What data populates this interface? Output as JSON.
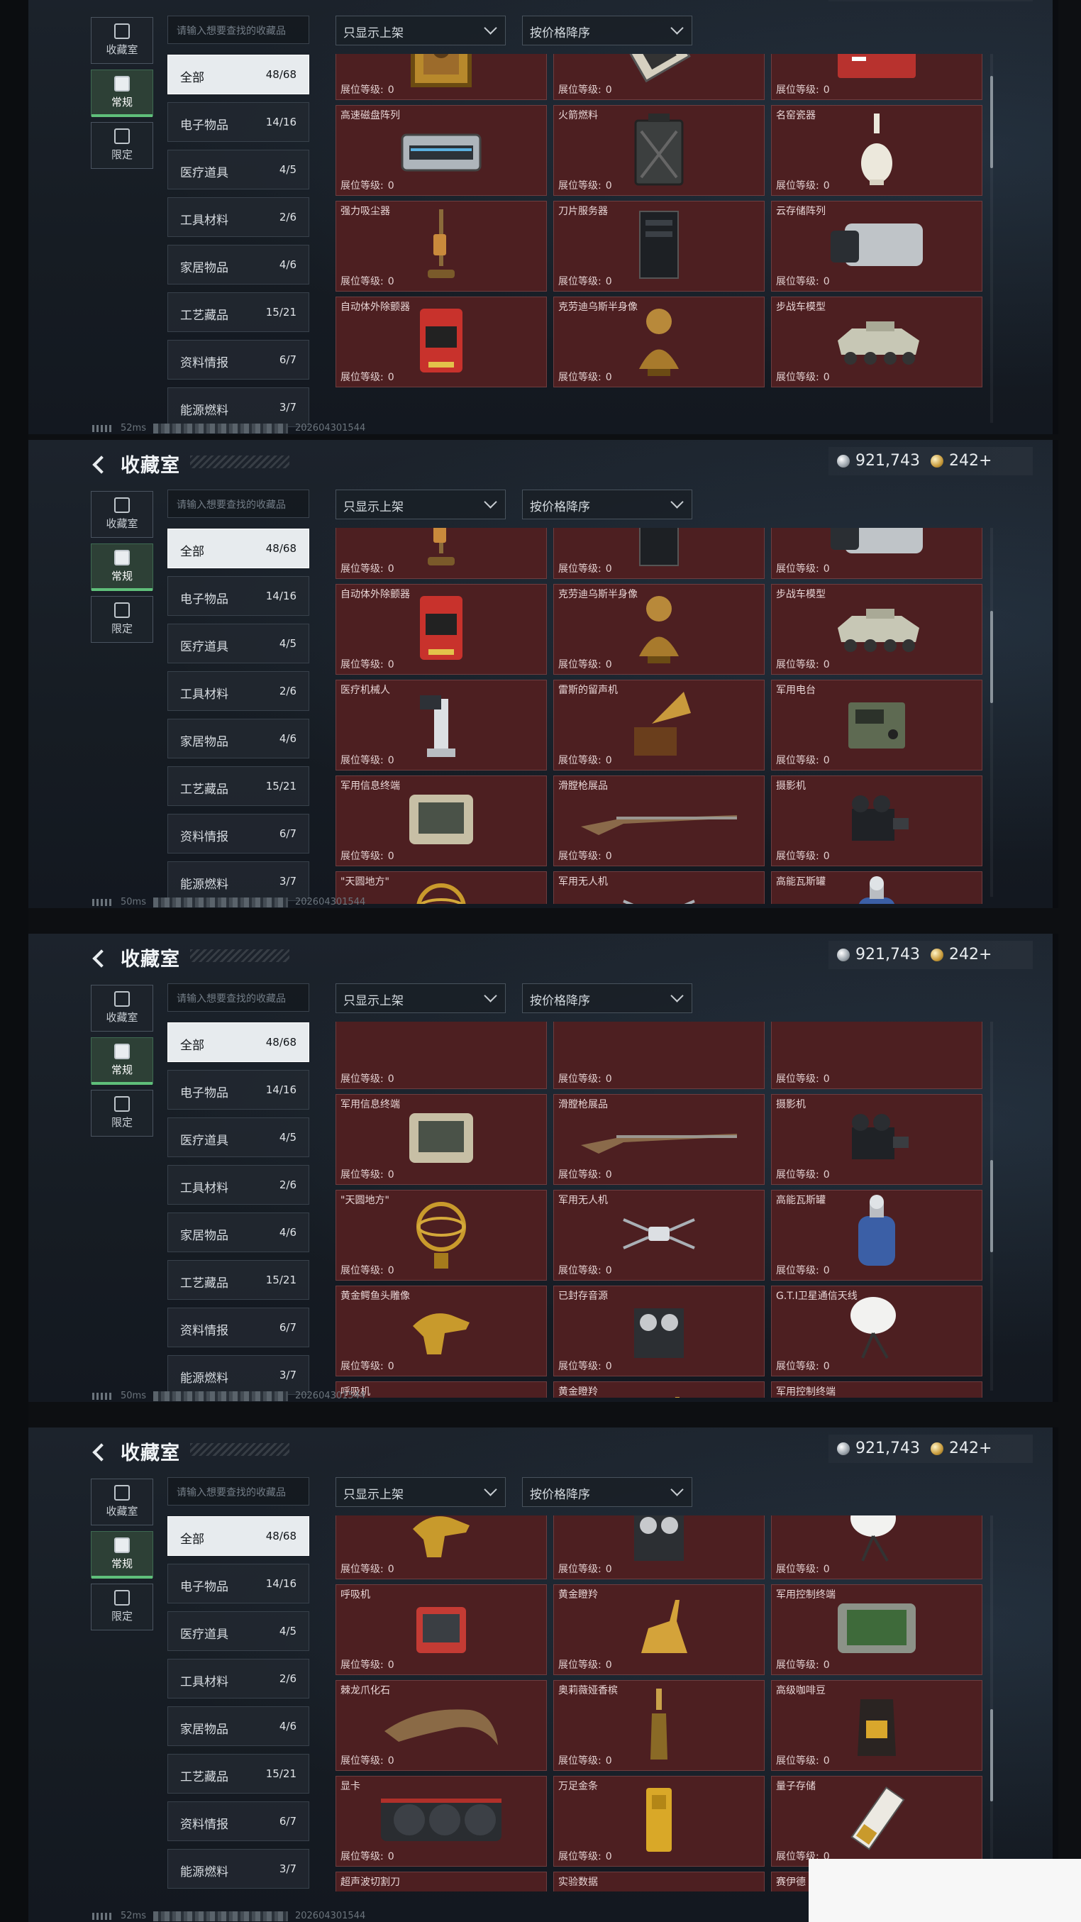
{
  "title": "收藏室",
  "currency": {
    "silver": "921,743",
    "gold": "242+"
  },
  "tabs": [
    {
      "label": "收藏室",
      "icon": "collection-icon"
    },
    {
      "label": "常规",
      "icon": "regular-icon"
    },
    {
      "label": "限定",
      "icon": "limited-icon"
    }
  ],
  "search_placeholder": "请输入想要查找的收藏品",
  "filter_label": "只显示上架",
  "sort_label": "按价格降序",
  "categories": [
    {
      "label": "全部",
      "count": "48/68"
    },
    {
      "label": "电子物品",
      "count": "14/16"
    },
    {
      "label": "医疗道具",
      "count": "4/5"
    },
    {
      "label": "工具材料",
      "count": "2/6"
    },
    {
      "label": "家居物品",
      "count": "4/6"
    },
    {
      "label": "工艺藏品",
      "count": "15/21"
    },
    {
      "label": "资料情报",
      "count": "6/7"
    },
    {
      "label": "能源燃料",
      "count": "3/7"
    }
  ],
  "level_label": "展位等级:",
  "level_value": "0",
  "panels": [
    {
      "ping": "52ms",
      "stamp": "202604301544",
      "scroll": 0.08,
      "rows": [
        [
          {
            "name": "",
            "icon": "painting-icon"
          },
          {
            "name": "",
            "icon": "chip-icon"
          },
          {
            "name": "",
            "icon": "fuel-can-icon"
          }
        ],
        [
          {
            "name": "高速磁盘阵列",
            "icon": "disk-array-icon"
          },
          {
            "name": "火箭燃料",
            "icon": "jerrycan-icon"
          },
          {
            "name": "名窑瓷器",
            "icon": "porcelain-vase-icon"
          }
        ],
        [
          {
            "name": "强力吸尘器",
            "icon": "vacuum-icon"
          },
          {
            "name": "刀片服务器",
            "icon": "server-icon"
          },
          {
            "name": "云存储阵列",
            "icon": "storage-array-icon"
          }
        ],
        [
          {
            "name": "自动体外除颤器",
            "icon": "defibrillator-icon"
          },
          {
            "name": "克劳迪乌斯半身像",
            "icon": "bust-icon"
          },
          {
            "name": "步战车模型",
            "icon": "tank-model-icon"
          }
        ]
      ]
    },
    {
      "ping": "50ms",
      "stamp": "202604301544",
      "scroll": 0.3,
      "rows": [
        [
          {
            "name": "",
            "icon": "vacuum-icon"
          },
          {
            "name": "",
            "icon": "server-icon"
          },
          {
            "name": "",
            "icon": "storage-array-icon"
          }
        ],
        [
          {
            "name": "自动体外除颤器",
            "icon": "defibrillator-icon"
          },
          {
            "name": "克劳迪乌斯半身像",
            "icon": "bust-icon"
          },
          {
            "name": "步战车模型",
            "icon": "tank-model-icon"
          }
        ],
        [
          {
            "name": "医疗机械人",
            "icon": "medical-robot-icon"
          },
          {
            "name": "雷斯的留声机",
            "icon": "gramophone-icon"
          },
          {
            "name": "军用电台",
            "icon": "radio-icon"
          }
        ],
        [
          {
            "name": "军用信息终端",
            "icon": "terminal-icon"
          },
          {
            "name": "滑膛枪展品",
            "icon": "musket-icon"
          },
          {
            "name": "摄影机",
            "icon": "camera-icon"
          }
        ],
        [
          {
            "name": "\"天圆地方\"",
            "icon": "armillary-icon"
          },
          {
            "name": "军用无人机",
            "icon": "drone-icon"
          },
          {
            "name": "高能瓦斯罐",
            "icon": "gas-tank-icon"
          }
        ]
      ]
    },
    {
      "ping": "50ms",
      "stamp": "202604301544",
      "scroll": 0.5,
      "rows": [
        [
          {
            "name": "",
            "icon": "blank-icon"
          },
          {
            "name": "",
            "icon": "blank-icon"
          },
          {
            "name": "",
            "icon": "blank-icon"
          }
        ],
        [
          {
            "name": "军用信息终端",
            "icon": "terminal-icon"
          },
          {
            "name": "滑膛枪展品",
            "icon": "musket-icon"
          },
          {
            "name": "摄影机",
            "icon": "camera-icon"
          }
        ],
        [
          {
            "name": "\"天圆地方\"",
            "icon": "armillary-icon"
          },
          {
            "name": "军用无人机",
            "icon": "drone-icon"
          },
          {
            "name": "高能瓦斯罐",
            "icon": "gas-tank-icon"
          }
        ],
        [
          {
            "name": "黄金鳄鱼头雕像",
            "icon": "croc-statue-icon"
          },
          {
            "name": "已封存音源",
            "icon": "tape-recorder-icon"
          },
          {
            "name": "G.T.I卫星通信天线",
            "icon": "satellite-dish-icon"
          }
        ],
        [
          {
            "name": "呼吸机",
            "icon": "ventilator-icon"
          },
          {
            "name": "黄金瞪羚",
            "icon": "gazelle-icon"
          },
          {
            "name": "军用控制终端",
            "icon": "control-terminal-icon"
          }
        ]
      ]
    },
    {
      "ping": "52ms",
      "stamp": "202604301544",
      "scroll": 0.7,
      "rows": [
        [
          {
            "name": "",
            "icon": "croc-statue-icon"
          },
          {
            "name": "",
            "icon": "tape-recorder-icon"
          },
          {
            "name": "",
            "icon": "satellite-dish-icon"
          }
        ],
        [
          {
            "name": "呼吸机",
            "icon": "ventilator-icon"
          },
          {
            "name": "黄金瞪羚",
            "icon": "gazelle-icon"
          },
          {
            "name": "军用控制终端",
            "icon": "control-terminal-icon"
          }
        ],
        [
          {
            "name": "棘龙爪化石",
            "icon": "claw-fossil-icon"
          },
          {
            "name": "奥莉薇娅香槟",
            "icon": "champagne-icon"
          },
          {
            "name": "高级咖啡豆",
            "icon": "coffee-bag-icon"
          }
        ],
        [
          {
            "name": "显卡",
            "icon": "gpu-icon"
          },
          {
            "name": "万足金条",
            "icon": "gold-bar-icon"
          },
          {
            "name": "量子存储",
            "icon": "quantum-storage-icon"
          }
        ],
        [
          {
            "name": "超声波切割刀",
            "icon": "blade-icon"
          },
          {
            "name": "实验数据",
            "icon": "data-icon"
          },
          {
            "name": "赛伊德",
            "icon": "blank-icon"
          }
        ]
      ]
    }
  ]
}
